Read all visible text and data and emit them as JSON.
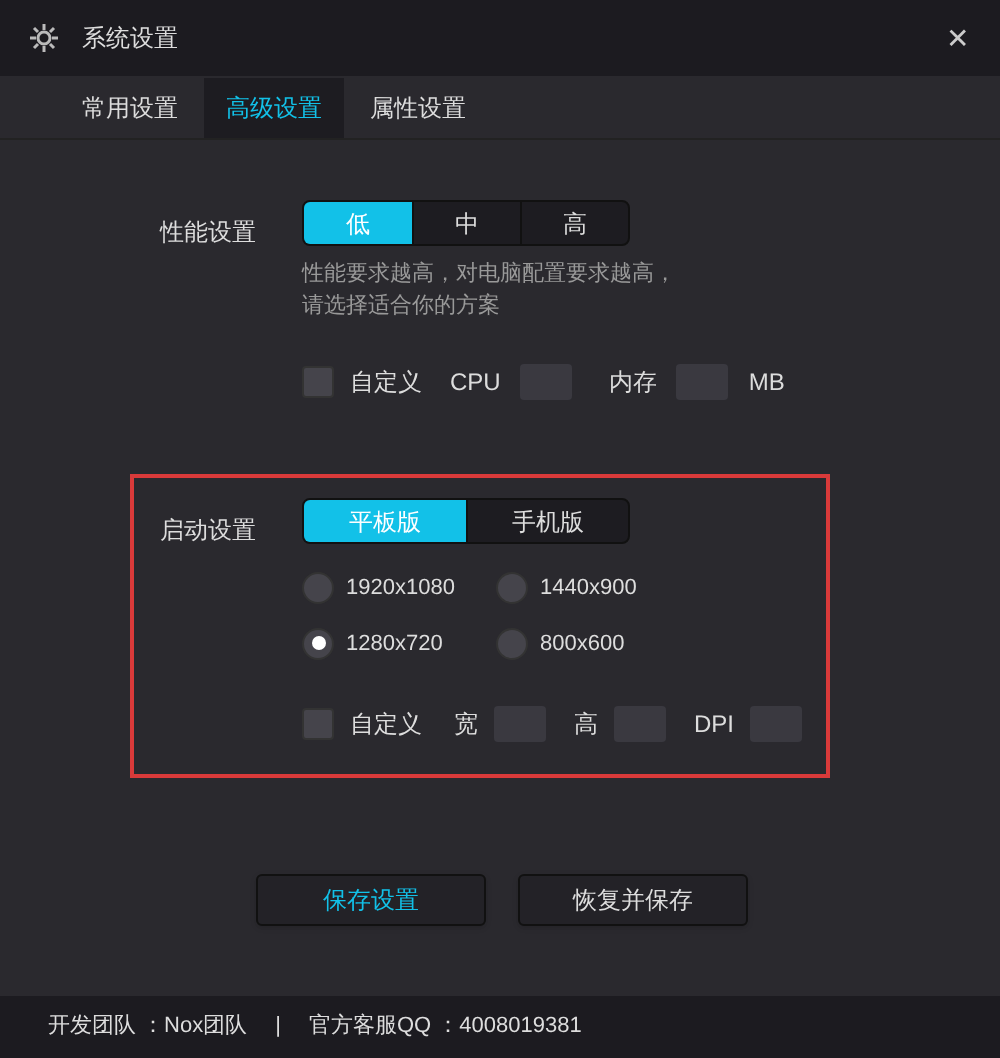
{
  "window": {
    "title": "系统设置",
    "close": "✕"
  },
  "tabs": [
    {
      "label": "常用设置",
      "selected": false
    },
    {
      "label": "高级设置",
      "selected": true
    },
    {
      "label": "属性设置",
      "selected": false
    }
  ],
  "performance": {
    "label": "性能设置",
    "options": [
      {
        "label": "低",
        "selected": true
      },
      {
        "label": "中",
        "selected": false
      },
      {
        "label": "高",
        "selected": false
      }
    ],
    "hint_lines": [
      "性能要求越高，对电脑配置要求越高，",
      "请选择适合你的方案"
    ],
    "custom": {
      "label": "自定义",
      "checked": false
    },
    "cpu_label": "CPU",
    "memory_label": "内存",
    "memory_unit": "MB"
  },
  "startup": {
    "highlighted": true,
    "label": "启动设置",
    "options": [
      {
        "label": "平板版",
        "selected": true
      },
      {
        "label": "手机版",
        "selected": false
      }
    ],
    "resolutions": [
      {
        "label": "1920x1080",
        "selected": false
      },
      {
        "label": "1440x900",
        "selected": false
      },
      {
        "label": "1280x720",
        "selected": true
      },
      {
        "label": "800x600",
        "selected": false
      }
    ],
    "custom": {
      "label": "自定义",
      "checked": false
    },
    "width_label": "宽",
    "height_label": "高",
    "dpi_label": "DPI"
  },
  "buttons": [
    {
      "label": "保存设置",
      "kind": "primary"
    },
    {
      "label": "恢复并保存",
      "kind": "secondary"
    }
  ],
  "footer": {
    "developer": "开发团队 ：Nox团队",
    "separator": "|",
    "support": "官方客服QQ ：4008019381"
  }
}
